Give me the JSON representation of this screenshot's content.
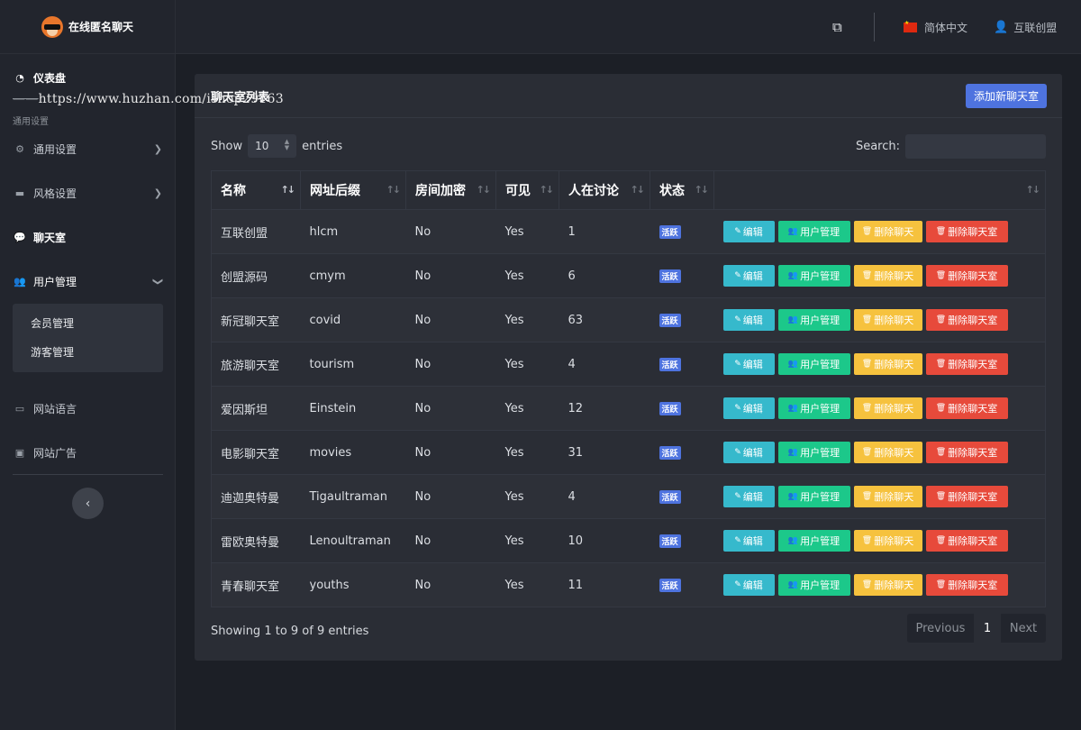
{
  "brand": {
    "title": "在线匿名聊天"
  },
  "watermark": "https://www.huzhan.com/ishop29163",
  "sidebar": {
    "dashboard": "仪表盘",
    "section_label": "通用设置",
    "items": [
      {
        "label": "通用设置",
        "icon": "gear-icon"
      },
      {
        "label": "风格设置",
        "icon": "card-icon"
      },
      {
        "label": "聊天室",
        "icon": "comments-icon"
      },
      {
        "label": "用户管理",
        "icon": "users-icon"
      },
      {
        "label": "网站语言",
        "icon": "language-icon"
      },
      {
        "label": "网站广告",
        "icon": "ad-icon"
      }
    ],
    "submenu": [
      "会员管理",
      "游客管理"
    ]
  },
  "header": {
    "language": "简体中文",
    "user": "互联创盟"
  },
  "card": {
    "title": "聊天室列表",
    "add_button": "添加新聊天室"
  },
  "table_controls": {
    "show_label": "Show",
    "page_size": "10",
    "entries_label": "entries",
    "search_label": "Search:"
  },
  "columns": [
    "名称",
    "网址后缀",
    "房间加密",
    "可见",
    "人在讨论",
    "状态",
    ""
  ],
  "rows": [
    {
      "name": "互联创盟",
      "slug": "hlcm",
      "encrypted": "No",
      "visible": "Yes",
      "count": "1",
      "status": "活跃"
    },
    {
      "name": "创盟源码",
      "slug": "cmym",
      "encrypted": "No",
      "visible": "Yes",
      "count": "6",
      "status": "活跃"
    },
    {
      "name": "新冠聊天室",
      "slug": "covid",
      "encrypted": "No",
      "visible": "Yes",
      "count": "63",
      "status": "活跃"
    },
    {
      "name": "旅游聊天室",
      "slug": "tourism",
      "encrypted": "No",
      "visible": "Yes",
      "count": "4",
      "status": "活跃"
    },
    {
      "name": "爱因斯坦",
      "slug": "Einstein",
      "encrypted": "No",
      "visible": "Yes",
      "count": "12",
      "status": "活跃"
    },
    {
      "name": "电影聊天室",
      "slug": "movies",
      "encrypted": "No",
      "visible": "Yes",
      "count": "31",
      "status": "活跃"
    },
    {
      "name": "迪迦奥特曼",
      "slug": "Tigaultraman",
      "encrypted": "No",
      "visible": "Yes",
      "count": "4",
      "status": "活跃"
    },
    {
      "name": "雷欧奥特曼",
      "slug": "Lenoultraman",
      "encrypted": "No",
      "visible": "Yes",
      "count": "10",
      "status": "活跃"
    },
    {
      "name": "青春聊天室",
      "slug": "youths",
      "encrypted": "No",
      "visible": "Yes",
      "count": "11",
      "status": "活跃"
    }
  ],
  "actions": {
    "edit": "编辑",
    "users": "用户管理",
    "delete_chat": "删除聊天",
    "delete_room": "删除聊天室"
  },
  "footer": {
    "info": "Showing 1 to 9 of 9 entries",
    "previous": "Previous",
    "page": "1",
    "next": "Next"
  },
  "colors": {
    "primary": "#4e73df",
    "info": "#36b9cc",
    "success": "#1cc88a",
    "warning": "#f6c23e",
    "danger": "#e74a3b"
  }
}
